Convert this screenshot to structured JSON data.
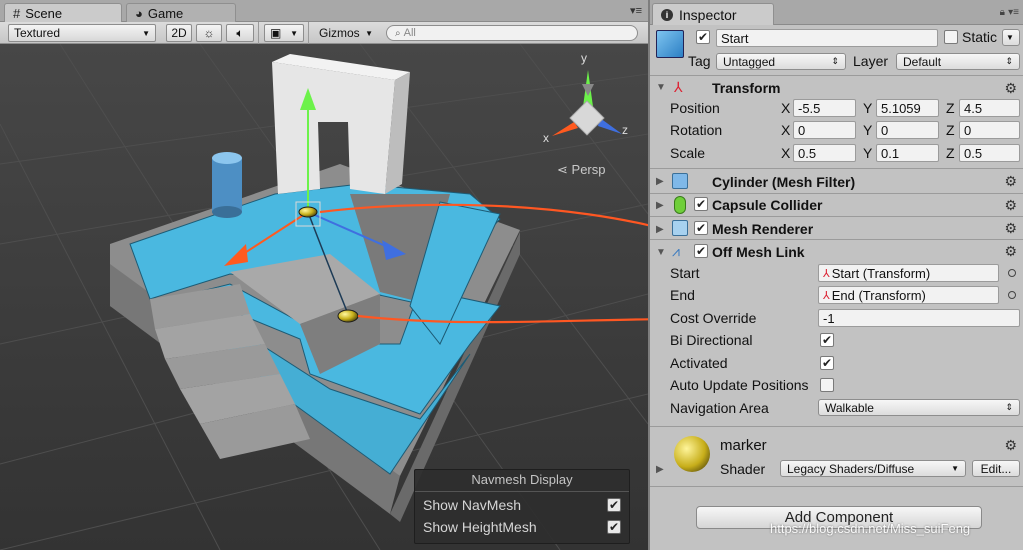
{
  "scene_panel": {
    "tabs": [
      {
        "label": "Scene",
        "icon": "hash-grid-icon",
        "active": true
      },
      {
        "label": "Game",
        "icon": "pacman-icon",
        "active": false
      }
    ],
    "toolbar": {
      "shading_mode": "Textured",
      "mode_2d": "2D",
      "gizmos_label": "Gizmos",
      "search_placeholder": "All"
    },
    "persp_label": "Persp",
    "gizmo_axes": {
      "x": "x",
      "y": "y",
      "z": "z"
    },
    "navmesh_display": {
      "title": "Navmesh Display",
      "show_navmesh_label": "Show NavMesh",
      "show_navmesh_checked": true,
      "show_heightmesh_label": "Show HeightMesh",
      "show_heightmesh_checked": true
    }
  },
  "inspector": {
    "tab_label": "Inspector",
    "object": {
      "active": true,
      "name": "Start",
      "static_label": "Static",
      "static_checked": false,
      "tag_label": "Tag",
      "tag_value": "Untagged",
      "layer_label": "Layer",
      "layer_value": "Default"
    },
    "transform": {
      "title": "Transform",
      "position_label": "Position",
      "position": {
        "x": "-5.5",
        "y": "5.1059",
        "z": "4.5"
      },
      "rotation_label": "Rotation",
      "rotation": {
        "x": "0",
        "y": "0",
        "z": "0"
      },
      "scale_label": "Scale",
      "scale": {
        "x": "0.5",
        "y": "0.1",
        "z": "0.5"
      },
      "axis_x": "X",
      "axis_y": "Y",
      "axis_z": "Z"
    },
    "components": {
      "mesh_filter": "Cylinder (Mesh Filter)",
      "capsule_collider": "Capsule Collider",
      "mesh_renderer": "Mesh Renderer",
      "off_mesh_link": "Off Mesh Link"
    },
    "off_mesh_link": {
      "start_label": "Start",
      "start_value": "Start (Transform)",
      "end_label": "End",
      "end_value": "End (Transform)",
      "cost_override_label": "Cost Override",
      "cost_override_value": "-1",
      "bi_directional_label": "Bi Directional",
      "bi_directional_checked": true,
      "activated_label": "Activated",
      "activated_checked": true,
      "auto_update_label": "Auto Update Positions",
      "auto_update_checked": false,
      "navigation_area_label": "Navigation Area",
      "navigation_area_value": "Walkable"
    },
    "material": {
      "name": "marker",
      "shader_label": "Shader",
      "shader_value": "Legacy Shaders/Diffuse",
      "edit_label": "Edit..."
    },
    "add_component_label": "Add Component"
  },
  "watermark": "https://blog.csdn.net/Miss_suiFeng",
  "colors": {
    "navmesh": "#4ab8e0",
    "annotation_arrow": "#ff5722",
    "scene_bg": "#3c3c3c",
    "inspector_bg": "#c2c2c2"
  }
}
